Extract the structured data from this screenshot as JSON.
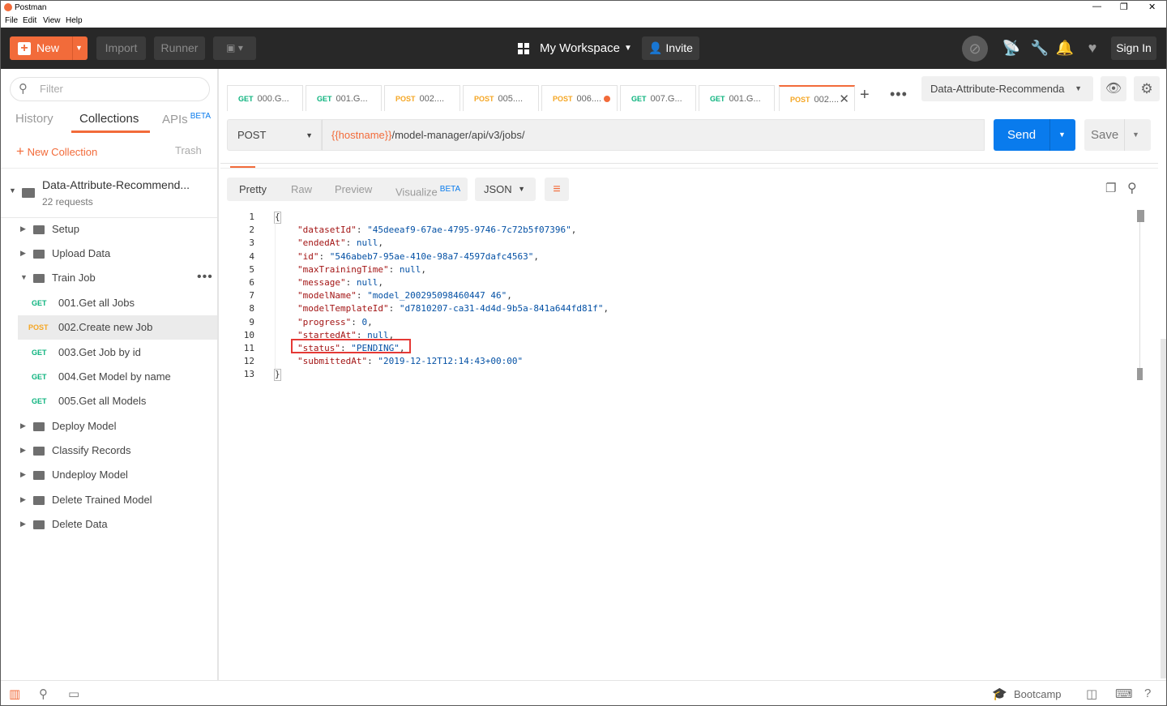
{
  "window": {
    "title": "Postman",
    "controls": [
      "—",
      "❐",
      "✕"
    ]
  },
  "menu": [
    "File",
    "Edit",
    "View",
    "Help"
  ],
  "header": {
    "new_label": "New",
    "import_label": "Import",
    "runner_label": "Runner",
    "workspace_label": "My Workspace",
    "invite_label": "Invite",
    "signin_label": "Sign In",
    "accent": "#f26b3a"
  },
  "sidebar": {
    "filter_placeholder": "Filter",
    "tabs": {
      "history": "History",
      "collections": "Collections",
      "apis": "APIs",
      "apis_badge": "BETA"
    },
    "new_collection": "New Collection",
    "trash": "Trash",
    "collection": {
      "name": "Data-Attribute-Recommend...",
      "count": "22 requests"
    },
    "folders": [
      {
        "label": "Setup"
      },
      {
        "label": "Upload Data"
      },
      {
        "label": "Train Job",
        "more": "•••"
      },
      {
        "label": "Deploy Model"
      },
      {
        "label": "Classify Records"
      },
      {
        "label": "Undeploy Model"
      },
      {
        "label": "Delete Trained Model"
      },
      {
        "label": "Delete Data"
      }
    ],
    "requests": [
      {
        "method": "GET",
        "name": "001.Get all Jobs"
      },
      {
        "method": "POST",
        "name": "002.Create new Job"
      },
      {
        "method": "GET",
        "name": "003.Get Job by id"
      },
      {
        "method": "GET",
        "name": "004.Get Model by name"
      },
      {
        "method": "GET",
        "name": "005.Get all Models"
      }
    ]
  },
  "tabs": [
    {
      "method": "GET",
      "name": "000.G..."
    },
    {
      "method": "GET",
      "name": "001.G..."
    },
    {
      "method": "POST",
      "name": "002...."
    },
    {
      "method": "POST",
      "name": "005...."
    },
    {
      "method": "POST",
      "name": "006...."
    },
    {
      "method": "GET",
      "name": "007.G..."
    },
    {
      "method": "GET",
      "name": "001.G..."
    },
    {
      "method": "POST",
      "name": "002...."
    }
  ],
  "environment": {
    "name": "Data-Attribute-Recommenda"
  },
  "request": {
    "method": "POST",
    "url_var": "{{hostname}}",
    "url_path": "/model-manager/api/v3/jobs/",
    "send_label": "Send",
    "save_label": "Save"
  },
  "response": {
    "views": {
      "pretty": "Pretty",
      "raw": "Raw",
      "preview": "Preview",
      "visualize": "Visualize",
      "visualize_badge": "BETA"
    },
    "format": "JSON",
    "lines": [
      {
        "n": "1",
        "k": "",
        "v": "",
        "open": "{"
      },
      {
        "n": "2",
        "k": "\"datasetId\"",
        "v": "\"45deeaf9-67ae-4795-9746-7c72b5f07396\"",
        "t": "s"
      },
      {
        "n": "3",
        "k": "\"endedAt\"",
        "v": "null",
        "t": "n"
      },
      {
        "n": "4",
        "k": "\"id\"",
        "v": "\"546abeb7-95ae-410e-98a7-4597dafc4563\"",
        "t": "s"
      },
      {
        "n": "5",
        "k": "\"maxTrainingTime\"",
        "v": "null",
        "t": "n"
      },
      {
        "n": "6",
        "k": "\"message\"",
        "v": "null",
        "t": "n"
      },
      {
        "n": "7",
        "k": "\"modelName\"",
        "v": "\"model_200295098460447 46\"",
        "t": "s"
      },
      {
        "n": "8",
        "k": "\"modelTemplateId\"",
        "v": "\"d7810207-ca31-4d4d-9b5a-841a644fd81f\"",
        "t": "s"
      },
      {
        "n": "9",
        "k": "\"progress\"",
        "v": "0",
        "t": "n"
      },
      {
        "n": "10",
        "k": "\"startedAt\"",
        "v": "null",
        "t": "n"
      },
      {
        "n": "11",
        "k": "\"status\"",
        "v": "\"PENDING\"",
        "t": "s"
      },
      {
        "n": "12",
        "k": "\"submittedAt\"",
        "v": "\"2019-12-12T12:14:43+00:00\"",
        "t": "s"
      },
      {
        "n": "13",
        "k": "",
        "v": "",
        "open": "}"
      }
    ]
  },
  "footer": {
    "bootcamp": "Bootcamp"
  }
}
